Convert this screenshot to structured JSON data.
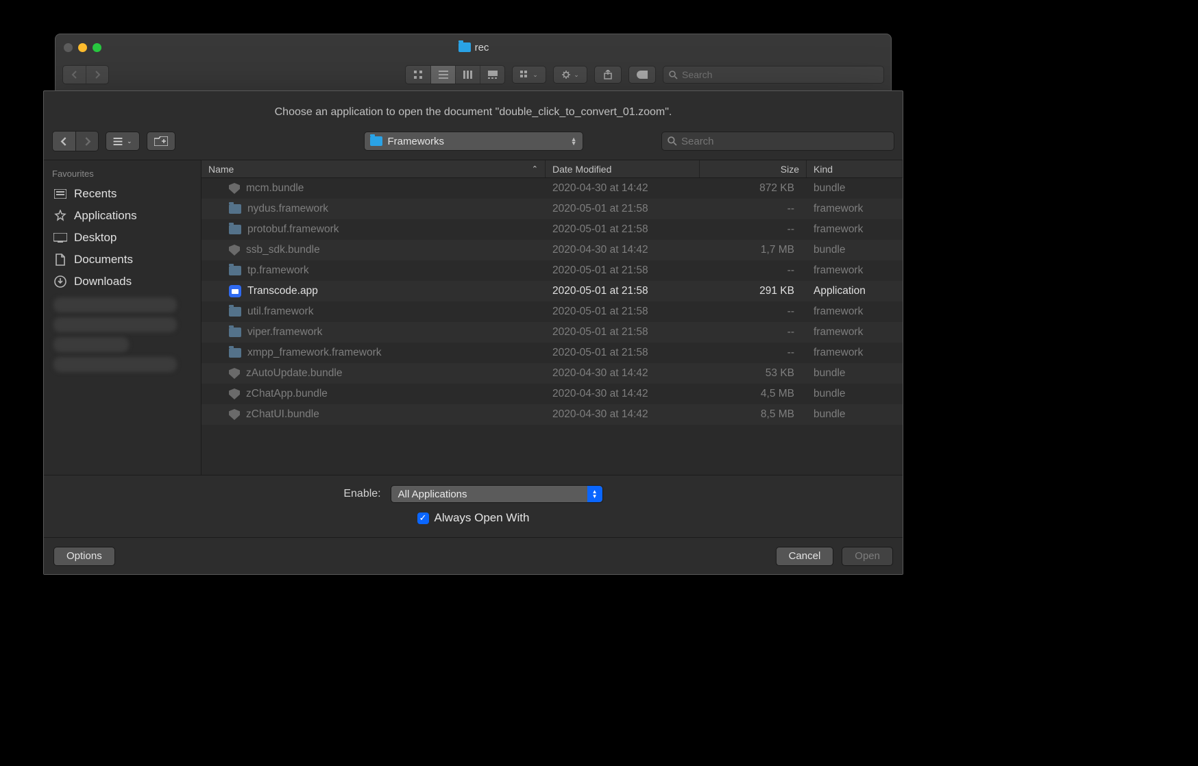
{
  "window": {
    "title": "rec"
  },
  "toolbar_search_placeholder": "Search",
  "sheet": {
    "prompt": "Choose an application to open the document \"double_click_to_convert_01.zoom\".",
    "path_label": "Frameworks",
    "search_placeholder": "Search",
    "enable_label": "Enable:",
    "enable_value": "All Applications",
    "always_open_label": "Always Open With",
    "options_button": "Options",
    "cancel_button": "Cancel",
    "open_button": "Open"
  },
  "sidebar": {
    "section_title": "Favourites",
    "items": [
      {
        "icon": "recents",
        "label": "Recents"
      },
      {
        "icon": "apps",
        "label": "Applications"
      },
      {
        "icon": "desktop",
        "label": "Desktop"
      },
      {
        "icon": "docs",
        "label": "Documents"
      },
      {
        "icon": "downloads",
        "label": "Downloads"
      }
    ]
  },
  "columns": {
    "name": "Name",
    "date": "Date Modified",
    "size": "Size",
    "kind": "Kind"
  },
  "rows": [
    {
      "icon": "shield",
      "name": "mcm.bundle",
      "date": "2020-04-30 at 14:42",
      "size": "872 KB",
      "kind": "bundle",
      "enabled": false
    },
    {
      "icon": "folder",
      "name": "nydus.framework",
      "date": "2020-05-01 at 21:58",
      "size": "--",
      "kind": "framework",
      "enabled": false
    },
    {
      "icon": "folder",
      "name": "protobuf.framework",
      "date": "2020-05-01 at 21:58",
      "size": "--",
      "kind": "framework",
      "enabled": false
    },
    {
      "icon": "shield",
      "name": "ssb_sdk.bundle",
      "date": "2020-04-30 at 14:42",
      "size": "1,7 MB",
      "kind": "bundle",
      "enabled": false
    },
    {
      "icon": "folder",
      "name": "tp.framework",
      "date": "2020-05-01 at 21:58",
      "size": "--",
      "kind": "framework",
      "enabled": false
    },
    {
      "icon": "app",
      "name": "Transcode.app",
      "date": "2020-05-01 at 21:58",
      "size": "291 KB",
      "kind": "Application",
      "enabled": true
    },
    {
      "icon": "folder",
      "name": "util.framework",
      "date": "2020-05-01 at 21:58",
      "size": "--",
      "kind": "framework",
      "enabled": false
    },
    {
      "icon": "folder",
      "name": "viper.framework",
      "date": "2020-05-01 at 21:58",
      "size": "--",
      "kind": "framework",
      "enabled": false
    },
    {
      "icon": "folder",
      "name": "xmpp_framework.framework",
      "date": "2020-05-01 at 21:58",
      "size": "--",
      "kind": "framework",
      "enabled": false
    },
    {
      "icon": "shield",
      "name": "zAutoUpdate.bundle",
      "date": "2020-04-30 at 14:42",
      "size": "53 KB",
      "kind": "bundle",
      "enabled": false
    },
    {
      "icon": "shield",
      "name": "zChatApp.bundle",
      "date": "2020-04-30 at 14:42",
      "size": "4,5 MB",
      "kind": "bundle",
      "enabled": false
    },
    {
      "icon": "shield",
      "name": "zChatUI.bundle",
      "date": "2020-04-30 at 14:42",
      "size": "8,5 MB",
      "kind": "bundle",
      "enabled": false
    }
  ]
}
